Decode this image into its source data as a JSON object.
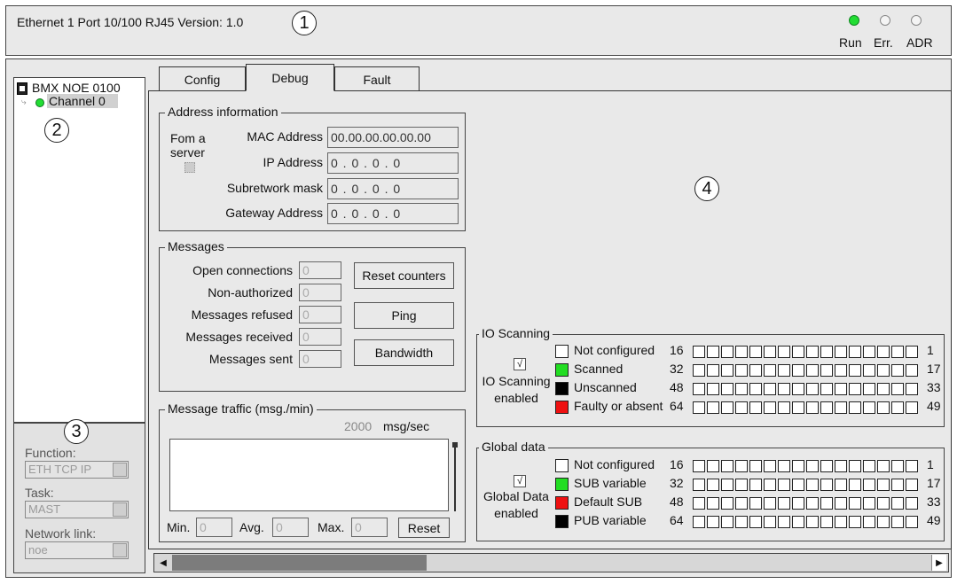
{
  "header": {
    "title": "Ethernet 1 Port 10/100 RJ45  Version: 1.0",
    "callout": "1",
    "leds": [
      {
        "label": "Run",
        "on": true
      },
      {
        "label": "Err.",
        "on": false
      },
      {
        "label": "ADR",
        "on": false
      }
    ]
  },
  "tree": {
    "module": "BMX NOE 0100",
    "channel": "Channel 0",
    "callout": "2"
  },
  "left_panel": {
    "callout": "3",
    "function_label": "Function:",
    "function_value": "ETH TCP IP",
    "task_label": "Task:",
    "task_value": "MAST",
    "network_label": "Network link:",
    "network_value": "noe"
  },
  "tabs": [
    {
      "label": "Config",
      "active": false
    },
    {
      "label": "Debug",
      "active": true
    },
    {
      "label": "Fault",
      "active": false
    }
  ],
  "address": {
    "title": "Address information",
    "from_server": "Fom a server",
    "mac_label": "MAC Address",
    "mac_value": "00.00.00.00.00.00",
    "ip_label": "IP Address",
    "ip_value": "0 . 0 . 0 . 0",
    "subnet_label": "Subretwork mask",
    "subnet_value": "0 . 0 . 0 . 0",
    "gateway_label": "Gateway Address",
    "gateway_value": "0 . 0 . 0 . 0"
  },
  "callout4": "4",
  "messages": {
    "title": "Messages",
    "rows": [
      {
        "label": "Open connections",
        "value": "0"
      },
      {
        "label": "Non-authorized",
        "value": "0"
      },
      {
        "label": "Messages refused",
        "value": "0"
      },
      {
        "label": "Messages received",
        "value": "0"
      },
      {
        "label": "Messages sent",
        "value": "0"
      }
    ],
    "reset_counters": "Reset counters",
    "ping": "Ping",
    "bandwidth": "Bandwidth"
  },
  "traffic": {
    "title": "Message traffic (msg./min)",
    "rate_value": "2000",
    "rate_unit": "msg/sec",
    "min_label": "Min.",
    "min_value": "0",
    "avg_label": "Avg.",
    "avg_value": "0",
    "max_label": "Max.",
    "max_value": "0",
    "reset": "Reset"
  },
  "io_scanning": {
    "title": "IO Scanning",
    "enabled_label": "IO Scanning enabled",
    "check": "√",
    "legend": [
      {
        "label": "Not configured",
        "color": "#ffffff"
      },
      {
        "label": "Scanned",
        "color": "#22dd22"
      },
      {
        "label": "Unscanned",
        "color": "#000000"
      },
      {
        "label": "Faulty or absent",
        "color": "#ee1111"
      }
    ],
    "rows": [
      {
        "left": "16",
        "right": "1"
      },
      {
        "left": "32",
        "right": "17"
      },
      {
        "left": "48",
        "right": "33"
      },
      {
        "left": "64",
        "right": "49"
      }
    ]
  },
  "global_data": {
    "title": "Global data",
    "enabled_label": "Global Data enabled",
    "check": "√",
    "legend": [
      {
        "label": "Not configured",
        "color": "#ffffff"
      },
      {
        "label": "SUB variable",
        "color": "#22dd22"
      },
      {
        "label": "Default SUB",
        "color": "#ee1111"
      },
      {
        "label": "PUB variable",
        "color": "#000000"
      }
    ],
    "rows": [
      {
        "left": "16",
        "right": "1"
      },
      {
        "left": "32",
        "right": "17"
      },
      {
        "left": "48",
        "right": "33"
      },
      {
        "left": "64",
        "right": "49"
      }
    ]
  }
}
